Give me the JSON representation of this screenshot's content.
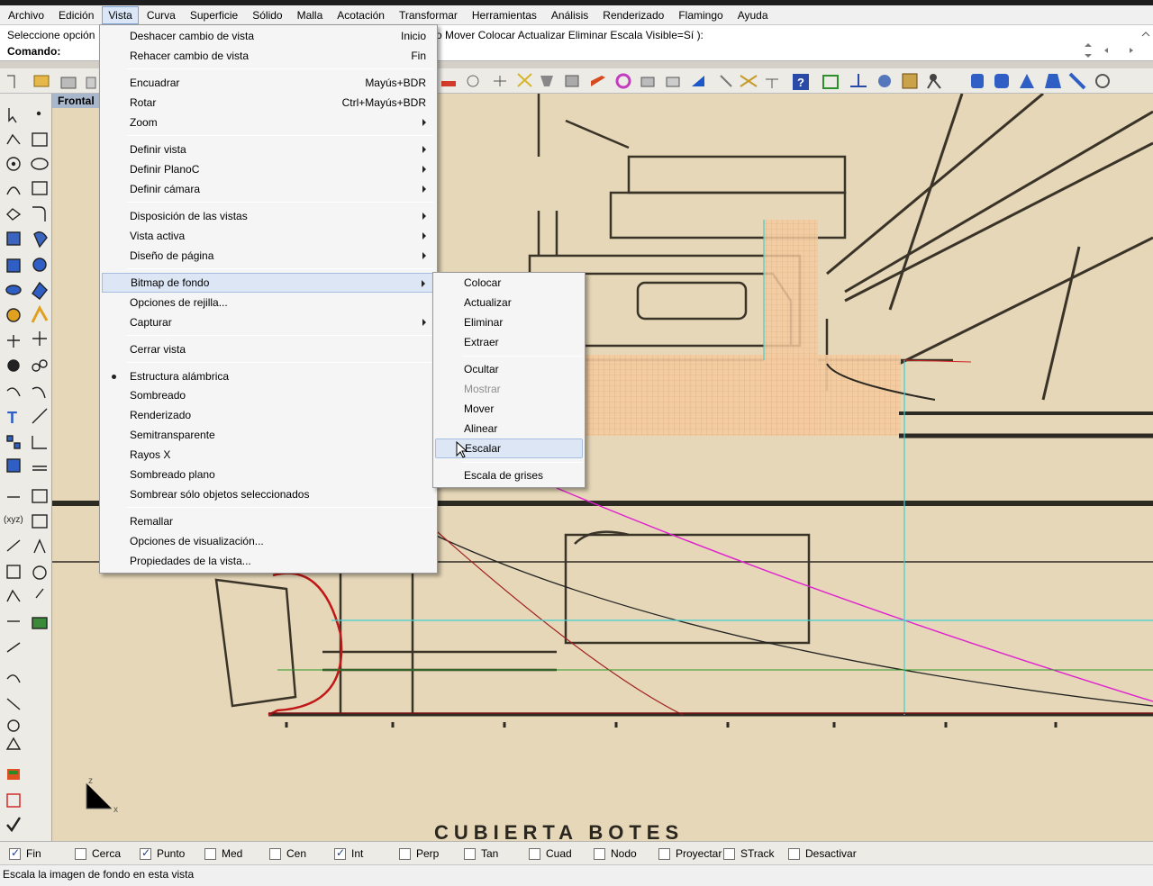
{
  "menubar": {
    "items": [
      "Archivo",
      "Edición",
      "Vista",
      "Curva",
      "Superficie",
      "Sólido",
      "Malla",
      "Acotación",
      "Transformar",
      "Herramientas",
      "Análisis",
      "Renderizado",
      "Flamingo",
      "Ayuda"
    ],
    "active": "Vista"
  },
  "command": {
    "prompt_start": "Seleccione opción",
    "prompt_end": "o Mover Colocar Actualizar Eliminar Escala Visible=Sí ):",
    "label": "Comando:"
  },
  "viewport": {
    "title": "Frontal",
    "bottom_text": "CUBIERTA BOTES",
    "axis_z": "z",
    "axis_x": "x"
  },
  "vista_menu": {
    "items": [
      {
        "label": "Deshacer cambio de vista",
        "shortcut": "Inicio"
      },
      {
        "label": "Rehacer cambio de vista",
        "shortcut": "Fin"
      },
      {
        "label": "Encuadrar",
        "shortcut": "Mayús+BDR"
      },
      {
        "label": "Rotar",
        "shortcut": "Ctrl+Mayús+BDR"
      },
      {
        "label": "Zoom",
        "submenu": true
      },
      {
        "label": "Definir vista",
        "submenu": true
      },
      {
        "label": "Definir PlanoC",
        "submenu": true
      },
      {
        "label": "Definir cámara",
        "submenu": true
      },
      {
        "label": "Disposición de las vistas",
        "submenu": true
      },
      {
        "label": "Vista activa",
        "submenu": true
      },
      {
        "label": "Diseño de página",
        "submenu": true
      },
      {
        "label": "Bitmap de fondo",
        "submenu": true,
        "highlighted": true
      },
      {
        "label": "Opciones de rejilla..."
      },
      {
        "label": "Capturar",
        "submenu": true
      },
      {
        "label": "Cerrar vista"
      },
      {
        "label": "Estructura alámbrica",
        "checked": true
      },
      {
        "label": "Sombreado"
      },
      {
        "label": "Renderizado"
      },
      {
        "label": "Semitransparente"
      },
      {
        "label": "Rayos X"
      },
      {
        "label": "Sombreado plano"
      },
      {
        "label": "Sombrear sólo objetos seleccionados"
      },
      {
        "label": "Remallar"
      },
      {
        "label": "Opciones de visualización..."
      },
      {
        "label": "Propiedades de la vista..."
      }
    ]
  },
  "bitmap_submenu": {
    "items": [
      {
        "label": "Colocar"
      },
      {
        "label": "Actualizar"
      },
      {
        "label": "Eliminar"
      },
      {
        "label": "Extraer"
      },
      {
        "label": "Ocultar"
      },
      {
        "label": "Mostrar",
        "disabled": true
      },
      {
        "label": "Mover"
      },
      {
        "label": "Alinear"
      },
      {
        "label": "Escalar",
        "highlighted": true
      },
      {
        "label": "Escala de grises"
      }
    ]
  },
  "osnap": {
    "items": [
      {
        "label": "Fin",
        "checked": true
      },
      {
        "label": "Cerca",
        "checked": false
      },
      {
        "label": "Punto",
        "checked": true
      },
      {
        "label": "Med",
        "checked": false
      },
      {
        "label": "Cen",
        "checked": false
      },
      {
        "label": "Int",
        "checked": true
      },
      {
        "label": "Perp",
        "checked": false
      },
      {
        "label": "Tan",
        "checked": false
      },
      {
        "label": "Cuad",
        "checked": false
      },
      {
        "label": "Nodo",
        "checked": false
      },
      {
        "label": "Proyectar",
        "checked": false
      },
      {
        "label": "STrack",
        "checked": false
      },
      {
        "label": "Desactivar",
        "checked": false
      }
    ]
  },
  "status": {
    "text": "Escala la imagen de fondo en esta vista"
  },
  "colors": {
    "menu_highlight": "#dce6f4",
    "paper": "#e9dcc0",
    "mesh": "#f2c79a",
    "cyan_line": "#3fd0d0",
    "magenta_curve": "#e020d0"
  }
}
